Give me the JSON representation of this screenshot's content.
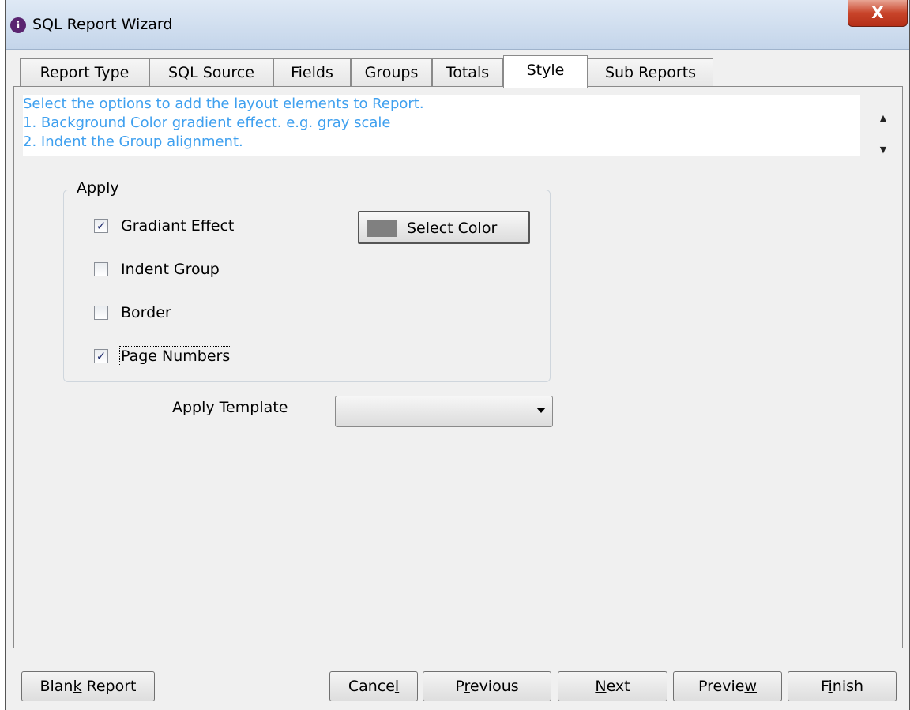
{
  "window": {
    "title": "SQL Report Wizard",
    "close_glyph": "X",
    "app_icon": "wizard-app-icon"
  },
  "tabs": [
    {
      "label": "Report Type",
      "active": false
    },
    {
      "label": "SQL Source",
      "active": false
    },
    {
      "label": "Fields",
      "active": false
    },
    {
      "label": "Groups",
      "active": false
    },
    {
      "label": "Totals",
      "active": false
    },
    {
      "label": "Style",
      "active": true
    },
    {
      "label": "Sub Reports",
      "active": false
    }
  ],
  "info": {
    "lines": [
      "Select the options to add the layout elements to Report.",
      "1. Background Color gradient effect. e.g. gray scale",
      "2. Indent the Group alignment."
    ],
    "scroll_up": "▲",
    "scroll_down": "▼"
  },
  "apply_group": {
    "legend": "Apply",
    "options": [
      {
        "label": "Gradiant Effect",
        "checked": true
      },
      {
        "label": "Indent Group",
        "checked": false
      },
      {
        "label": "Border",
        "checked": false
      },
      {
        "label": "Page Numbers",
        "checked": true
      }
    ],
    "select_color_label": "Select Color",
    "swatch_color": "#808080"
  },
  "template": {
    "label": "Apply Template",
    "value": ""
  },
  "buttons": {
    "blank_report": {
      "pre": "Blan",
      "mnemonic": "k",
      "post": " Report"
    },
    "cancel": {
      "pre": "Cance",
      "mnemonic": "l",
      "post": ""
    },
    "previous": {
      "pre": "P",
      "mnemonic": "r",
      "post": "evious"
    },
    "next": {
      "pre": "",
      "mnemonic": "N",
      "post": "ext"
    },
    "preview": {
      "pre": "Previe",
      "mnemonic": "w",
      "post": ""
    },
    "finish": {
      "pre": "F",
      "mnemonic": "i",
      "post": "nish"
    }
  },
  "colors": {
    "info_text": "#3fa0ef",
    "close_button": "#c8442a",
    "check_mark": "#1e2b6f"
  }
}
